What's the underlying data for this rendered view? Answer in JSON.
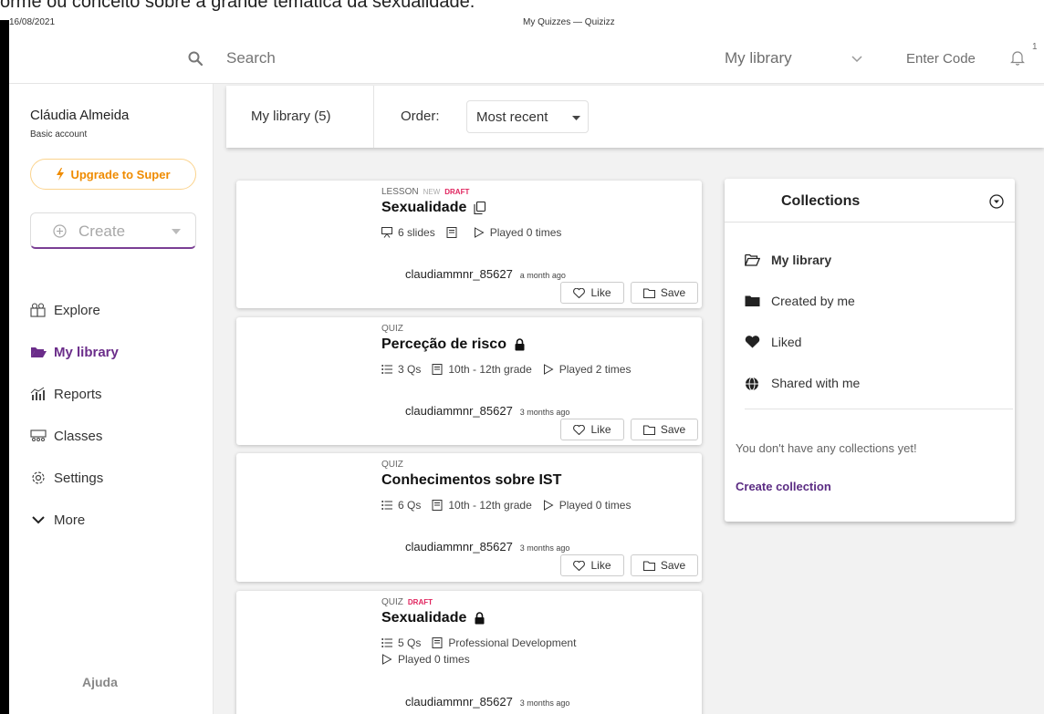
{
  "caption": "orme ou conceito sobre a grande temática da sexualidade.",
  "print_header": {
    "date": "16/08/2021",
    "title": "My Quizzes — Quizizz"
  },
  "topbar": {
    "search_placeholder": "Search",
    "library_select": "My library",
    "enter_code": "Enter Code",
    "notification_count": "1"
  },
  "sidebar": {
    "user_name": "Cláudia Almeida",
    "account_type": "Basic account",
    "upgrade_label": "Upgrade to Super",
    "create_label": "Create",
    "nav": [
      {
        "label": "Explore",
        "icon": "explore-icon"
      },
      {
        "label": "My library",
        "icon": "folder-open-icon",
        "active": true
      },
      {
        "label": "Reports",
        "icon": "reports-icon"
      },
      {
        "label": "Classes",
        "icon": "classes-icon"
      },
      {
        "label": "Settings",
        "icon": "gear-icon"
      },
      {
        "label": "More",
        "icon": "chevron-down-icon"
      }
    ],
    "help_label": "Ajuda"
  },
  "library_bar": {
    "count_label": "My library (5)",
    "order_label": "Order:",
    "order_value": "Most recent"
  },
  "cards": [
    {
      "type": "LESSON",
      "new": "NEW",
      "draft": "DRAFT",
      "title": "Sexualidade",
      "meta": [
        "6 slides",
        "",
        "Played 0 times"
      ],
      "author": "claudiammnr_85627",
      "ago": "a month ago",
      "like": "Like",
      "save": "Save"
    },
    {
      "type": "QUIZ",
      "title": "Perceção de risco",
      "meta": [
        "3 Qs",
        "10th - 12th grade",
        "Played 2 times"
      ],
      "author": "claudiammnr_85627",
      "ago": "3 months ago",
      "like": "Like",
      "save": "Save"
    },
    {
      "type": "QUIZ",
      "title": "Conhecimentos sobre IST",
      "meta": [
        "6 Qs",
        "10th - 12th grade",
        "Played 0 times"
      ],
      "author": "claudiammnr_85627",
      "ago": "3 months ago",
      "like": "Like",
      "save": "Save"
    },
    {
      "type": "QUIZ",
      "draft": "DRAFT",
      "title": "Sexualidade",
      "meta": [
        "5 Qs",
        "Professional Development",
        "Played 0 times"
      ],
      "author": "claudiammnr_85627",
      "ago": "3 months ago"
    }
  ],
  "collections": {
    "title": "Collections",
    "items": [
      "My library",
      "Created by me",
      "Liked",
      "Shared with me"
    ],
    "empty_message": "You don't have any collections yet!",
    "create_link": "Create collection"
  },
  "colors": {
    "brand_purple": "#6b2d8a",
    "upgrade_orange": "#ef8b00",
    "draft_pink": "#e0245e"
  }
}
